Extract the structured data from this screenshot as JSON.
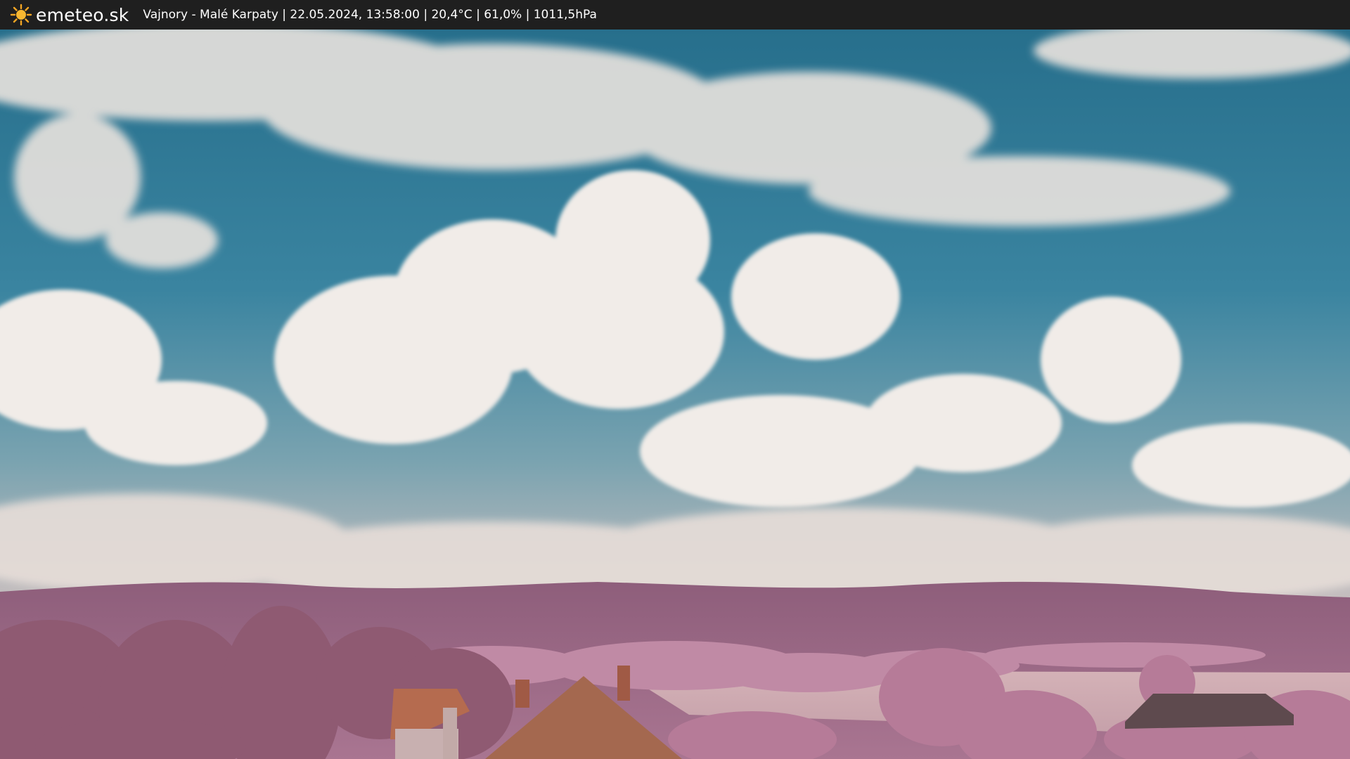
{
  "header": {
    "brand": "emeteo.sk",
    "info": "Vajnory - Malé Karpaty | 22.05.2024, 13:58:00 | 20,4°C | 61,0% | 1011,5hPa"
  },
  "icons": {
    "logo": "sun-icon"
  },
  "colors": {
    "bar": "#1f1f1f",
    "sun": "#f5a623",
    "sky": "#2f7a94",
    "cloud": "#efe9e4",
    "hills": "#9b6a86",
    "foliage": "#b57c98",
    "roof": "#b86a4e"
  }
}
